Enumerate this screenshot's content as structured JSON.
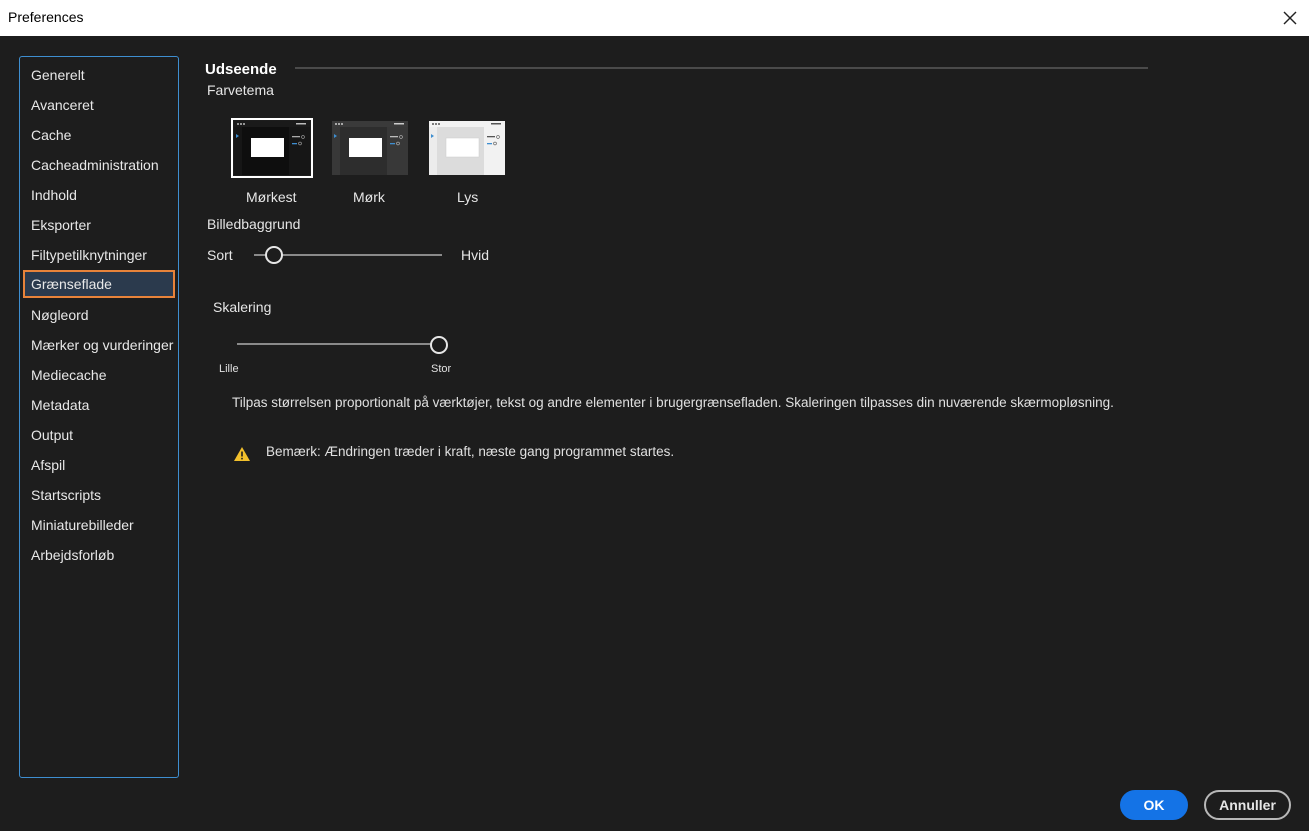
{
  "window": {
    "title": "Preferences",
    "close_icon": "close-icon"
  },
  "sidebar": {
    "items": [
      {
        "label": "Generelt"
      },
      {
        "label": "Avanceret"
      },
      {
        "label": "Cache"
      },
      {
        "label": "Cacheadministration"
      },
      {
        "label": "Indhold"
      },
      {
        "label": "Eksporter"
      },
      {
        "label": "Filtypetilknytninger"
      },
      {
        "label": "Grænseflade",
        "selected": true
      },
      {
        "label": "Nøgleord"
      },
      {
        "label": "Mærker og vurderinger"
      },
      {
        "label": "Mediecache"
      },
      {
        "label": "Metadata"
      },
      {
        "label": "Output"
      },
      {
        "label": "Afspil"
      },
      {
        "label": "Startscripts"
      },
      {
        "label": "Miniaturebilleder"
      },
      {
        "label": "Arbejdsforløb"
      }
    ],
    "border_color": "#3e8ed0",
    "selected_border_color": "#e8833a"
  },
  "main": {
    "section_title": "Udseende",
    "color_theme": {
      "label": "Farvetema",
      "options": [
        {
          "label": "Mørkest",
          "selected": true
        },
        {
          "label": "Mørk",
          "selected": false
        },
        {
          "label": "Lys",
          "selected": false
        }
      ]
    },
    "image_background": {
      "label": "Billedbaggrund",
      "min_label": "Sort",
      "max_label": "Hvid",
      "value_fraction": 0.1
    },
    "scaling": {
      "label": "Skalering",
      "min_label": "Lille",
      "max_label": "Stor",
      "value_fraction": 1.0,
      "description": "Tilpas størrelsen proportionalt på værktøjer, tekst og andre elementer i brugergrænsefladen. Skaleringen tilpasses din nuværende skærmopløsning."
    },
    "note": {
      "icon": "warning-icon",
      "text": "Bemærk: Ændringen træder i kraft, næste gang programmet startes."
    }
  },
  "footer": {
    "ok_label": "OK",
    "cancel_label": "Annuller",
    "accent_color": "#1473e6"
  }
}
